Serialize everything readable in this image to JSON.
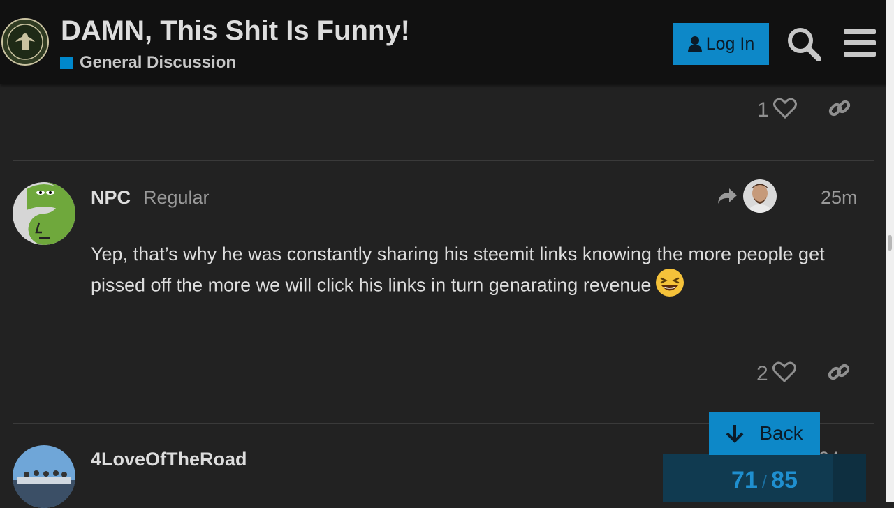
{
  "header": {
    "logo_alt": "site-logo",
    "title": "DAMN, This Shit Is Funny!",
    "category": "General Discussion",
    "category_color": "#0088cc",
    "login_label": "Log In",
    "accent": "#0d88c8"
  },
  "posts": [
    {
      "likes": "1"
    },
    {
      "username": "NPC",
      "user_title": "Regular",
      "date": "25m",
      "body": "Yep, that’s why he was constantly sharing his steemit links knowing the more people get pissed off the more we will click his links in turn genarating revenue",
      "emoji": "laughing-emoji",
      "likes": "2"
    },
    {
      "username": "4LoveOfTheRoad",
      "date": "24m"
    }
  ],
  "timeline": {
    "back_label": "Back",
    "current": "71",
    "separator": "/",
    "total": "85",
    "progress": 0.835
  }
}
